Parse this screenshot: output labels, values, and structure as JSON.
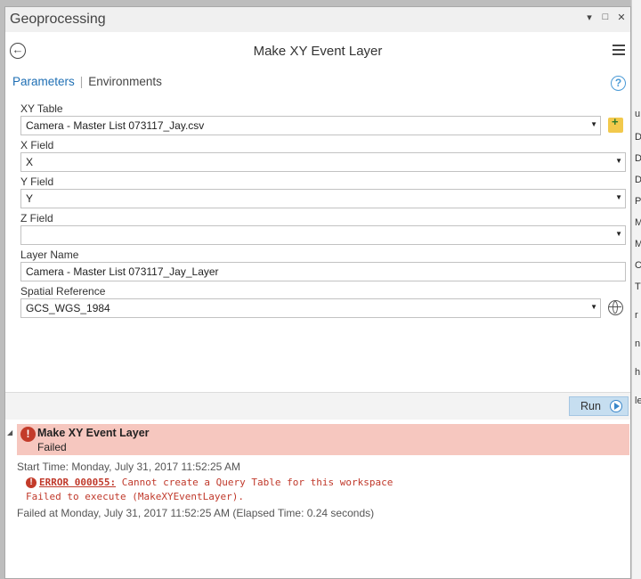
{
  "window": {
    "title": "Geoprocessing",
    "controls": {
      "pin": "▾",
      "restore": "□",
      "close": "✕"
    }
  },
  "tool": {
    "title": "Make XY Event Layer"
  },
  "tabs": {
    "parameters": "Parameters",
    "separator": "|",
    "environments": "Environments"
  },
  "help_icon": "?",
  "params": {
    "xy_table": {
      "label": "XY Table",
      "value": "Camera - Master List 073117_Jay.csv"
    },
    "x_field": {
      "label": "X Field",
      "value": "X"
    },
    "y_field": {
      "label": "Y Field",
      "value": "Y"
    },
    "z_field": {
      "label": "Z Field",
      "value": ""
    },
    "layer_name": {
      "label": "Layer Name",
      "value": "Camera - Master List 073117_Jay_Layer"
    },
    "spatial_ref": {
      "label": "Spatial Reference",
      "value": "GCS_WGS_1984"
    }
  },
  "run": {
    "label": "Run"
  },
  "messages": {
    "title": "Make XY Event Layer",
    "status": "Failed",
    "start_time": "Start Time: Monday, July 31, 2017 11:52:25 AM",
    "error_code": "ERROR 000055:",
    "error_text": " Cannot create a Query Table for this workspace",
    "error_line2": "Failed to execute (MakeXYEventLayer).",
    "failed_at": "Failed at Monday, July 31, 2017 11:52:25 AM (Elapsed Time: 0.24 seconds)"
  },
  "background_strip": [
    "u",
    "D",
    "D",
    "D",
    "P",
    "M",
    "M",
    "C",
    "T",
    "r",
    "n",
    "h",
    "le"
  ],
  "colors": {
    "accent": "#1f6fb4",
    "error": "#c0392b",
    "error_banner": "#f6c7bf",
    "run_button": "#c6def0"
  }
}
